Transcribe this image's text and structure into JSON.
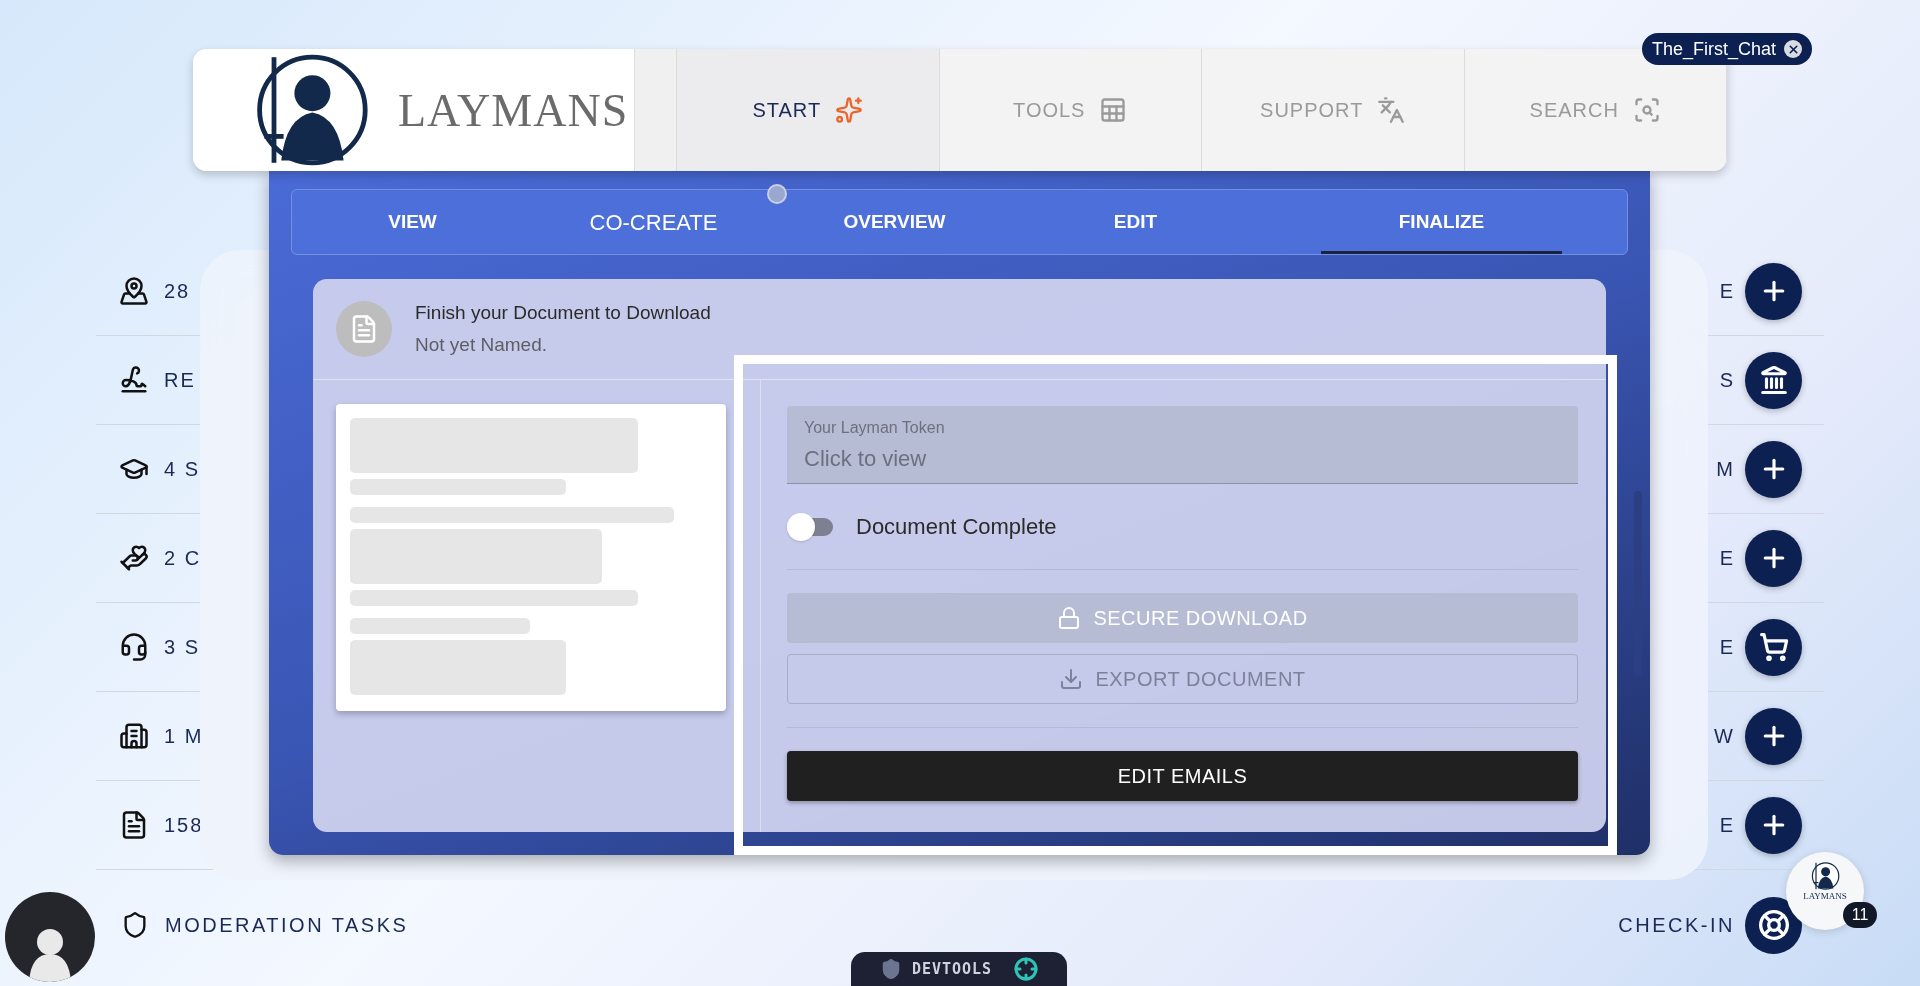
{
  "header": {
    "logo_text": "LAYMANS",
    "nav": [
      {
        "label": "START",
        "selected": true
      },
      {
        "label": "TOOLS",
        "selected": false
      },
      {
        "label": "SUPPORT",
        "selected": false
      },
      {
        "label": "SEARCH",
        "selected": false
      }
    ]
  },
  "chat_chip": {
    "label": "The_First_Chat"
  },
  "list": [
    {
      "left_text": "28",
      "right_text": "E"
    },
    {
      "left_text": "RE",
      "right_text": "S"
    },
    {
      "left_text": "4 S",
      "right_text": "M"
    },
    {
      "left_text": "2 C",
      "right_text": "E"
    },
    {
      "left_text": "3 S",
      "right_text": "E"
    },
    {
      "left_text": "1 M",
      "right_text": "W"
    },
    {
      "left_text": "158",
      "right_text": "E"
    }
  ],
  "footer": {
    "left_label": "MODERATION TASKS",
    "right_label": "CHECK-IN"
  },
  "dialog": {
    "tabs": [
      {
        "label": "VIEW",
        "selected": false,
        "bold": true
      },
      {
        "label": "CO-CREATE",
        "selected": false,
        "bold": false
      },
      {
        "label": "OVERVIEW",
        "selected": false,
        "bold": true
      },
      {
        "label": "EDIT",
        "selected": false,
        "bold": true
      },
      {
        "label": "FINALIZE",
        "selected": true,
        "bold": true
      }
    ],
    "card": {
      "title": "Finish your Document to Download",
      "subtitle": "Not yet Named.",
      "token_field": {
        "label": "Your Layman Token",
        "placeholder": "Click to view"
      },
      "toggle": {
        "label": "Document Complete",
        "on": false
      },
      "buttons": [
        {
          "label": "SECURE DOWNLOAD",
          "kind": "contained",
          "disabled": true
        },
        {
          "label": "EXPORT DOCUMENT",
          "kind": "outlined",
          "disabled": true
        },
        {
          "label": "EDIT EMAILS",
          "kind": "contained",
          "disabled": false
        }
      ]
    }
  },
  "chat_badge": {
    "count": "11",
    "logo_text": "LAYMANS"
  },
  "devtools": {
    "label": "DEVTOOLS"
  }
}
